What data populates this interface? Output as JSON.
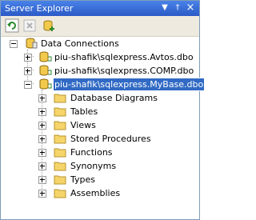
{
  "window": {
    "title": "Server Explorer"
  },
  "titlebar": {
    "dropdown_glyph": "▼",
    "pin_glyph": "†",
    "close_glyph": "×"
  },
  "toolbar": {
    "buttons": [
      "refresh-icon",
      "stop-icon",
      "add-connection-icon"
    ]
  },
  "tree": {
    "root": {
      "label": "Data Connections"
    },
    "connections": [
      {
        "label": "piu-shafik\\sqlexpress.Avtos.dbo"
      },
      {
        "label": "piu-shafik\\sqlexpress.COMP.dbo"
      },
      {
        "label": "piu-shafik\\sqlexpress.MyBase.dbo"
      }
    ],
    "folders": [
      {
        "label": "Database Diagrams"
      },
      {
        "label": "Tables"
      },
      {
        "label": "Views"
      },
      {
        "label": "Stored Procedures"
      },
      {
        "label": "Functions"
      },
      {
        "label": "Synonyms"
      },
      {
        "label": "Types"
      },
      {
        "label": "Assemblies"
      }
    ]
  },
  "colors": {
    "titlebar": "#3c6ed3",
    "selection": "#316ac5",
    "folder": "#f5d46a"
  }
}
